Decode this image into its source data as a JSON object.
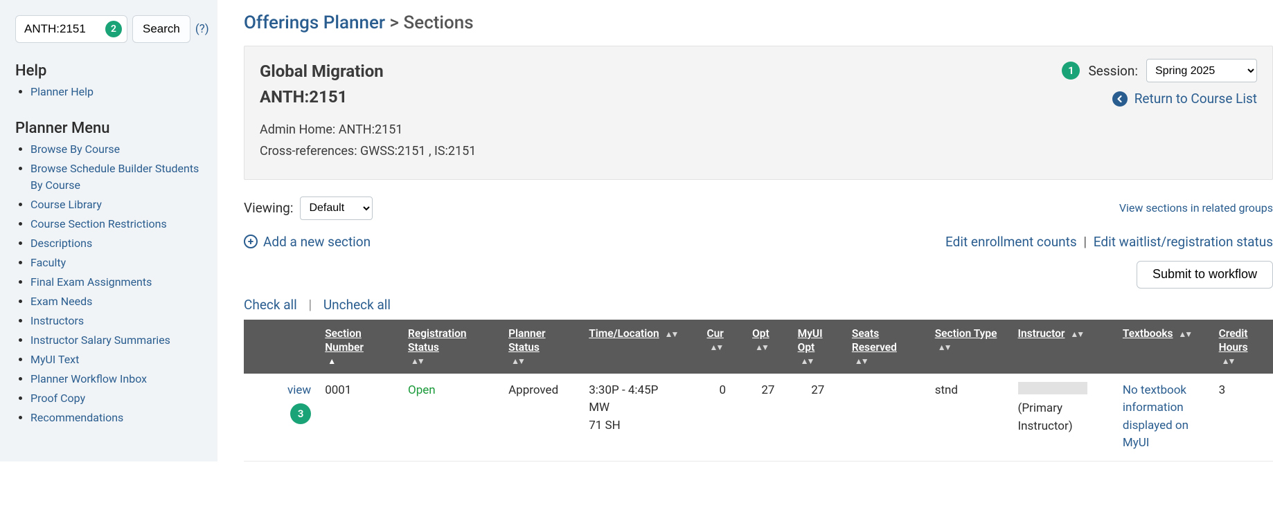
{
  "sidebar": {
    "search_value": "ANTH:2151",
    "badge_search": "2",
    "search_button": "Search",
    "help_question": "(?)",
    "help_heading": "Help",
    "help_items": [
      "Planner Help"
    ],
    "menu_heading": "Planner Menu",
    "menu_items": [
      "Browse By Course",
      "Browse Schedule Builder Students By Course",
      "Course Library",
      "Course Section Restrictions",
      "Descriptions",
      "Faculty",
      "Final Exam Assignments",
      "Exam Needs",
      "Instructors",
      "Instructor Salary Summaries",
      "MyUI Text",
      "Planner Workflow Inbox",
      "Proof Copy",
      "Recommendations"
    ]
  },
  "breadcrumb": {
    "root": "Offerings Planner",
    "sep": ">",
    "current": "Sections"
  },
  "course": {
    "title": "Global Migration",
    "code": "ANTH:2151",
    "admin_label": "Admin Home:",
    "admin_value": "ANTH:2151",
    "xref_label": "Cross-references:",
    "xref_value": "GWSS:2151 , IS:2151",
    "badge_session": "1",
    "session_label": "Session:",
    "session_value": "Spring 2025",
    "return_label": "Return to Course List"
  },
  "viewing": {
    "label": "Viewing:",
    "value": "Default",
    "related_link": "View sections in related groups"
  },
  "actions": {
    "add_section": "Add a new section",
    "edit_enroll": "Edit enrollment counts",
    "edit_waitlist": "Edit waitlist/registration status",
    "submit": "Submit to workflow",
    "check_all": "Check all",
    "uncheck_all": "Uncheck all"
  },
  "table": {
    "headers": {
      "section_number": "Section Number",
      "reg_status": "Registration Status",
      "planner_status": "Planner Status",
      "time_location": "Time/Location",
      "cur": "Cur",
      "opt": "Opt",
      "myui_opt": "MyUI Opt",
      "seats_reserved": "Seats Reserved",
      "section_type": "Section Type",
      "instructor": "Instructor",
      "textbooks": "Textbooks",
      "credit_hours": "Credit Hours"
    },
    "row": {
      "view_label": "view",
      "view_badge": "3",
      "section_number": "0001",
      "reg_status": "Open",
      "planner_status": "Approved",
      "time1": "3:30P - 4:45P",
      "time2": "MW",
      "time3": "71 SH",
      "cur": "0",
      "opt": "27",
      "myui_opt": "27",
      "seats_reserved": "",
      "section_type": "stnd",
      "instructor_role": "(Primary Instructor)",
      "textbooks": "No textbook information displayed on MyUI",
      "credit_hours": "3"
    }
  }
}
